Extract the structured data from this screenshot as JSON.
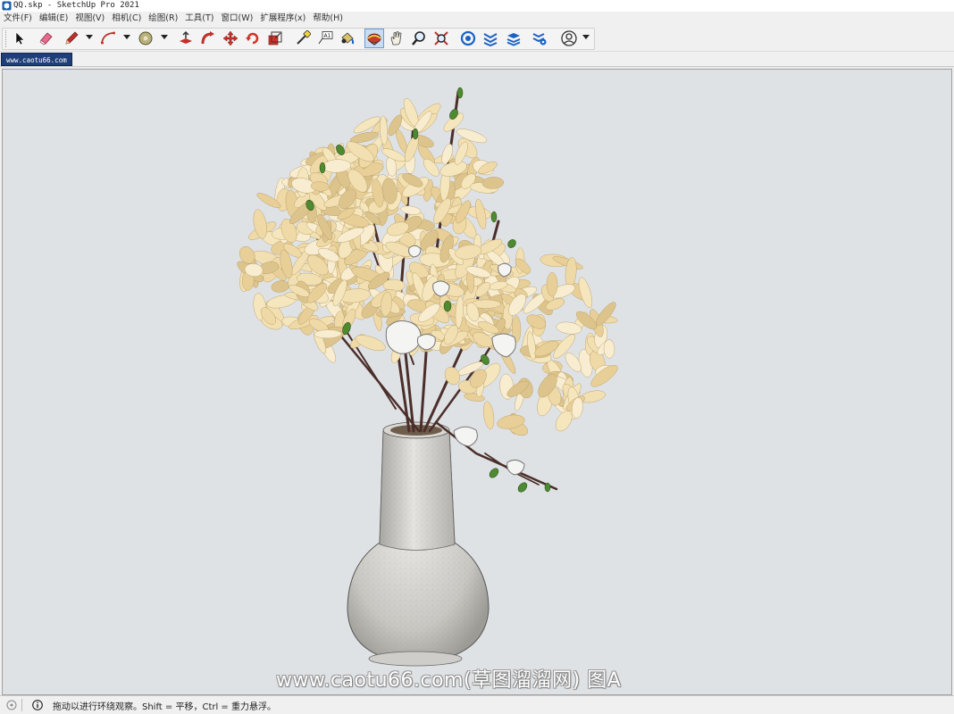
{
  "window": {
    "title": "QQ.skp - SketchUp Pro 2021"
  },
  "menu": {
    "items": [
      "文件(F)",
      "编辑(E)",
      "视图(V)",
      "相机(C)",
      "绘图(R)",
      "工具(T)",
      "窗口(W)",
      "扩展程序(x)",
      "帮助(H)"
    ]
  },
  "toolbar": {
    "active_tool": "orbit"
  },
  "scene_tabs": {
    "active_label": "www.caotu66.com"
  },
  "viewport": {
    "background_color": "#dfe2e5",
    "watermark": "www.caotu66.com(草图溜溜网) 图A"
  },
  "status": {
    "hint": "拖动以进行环绕观察。Shift = 平移，Ctrl = 重力悬浮。"
  }
}
